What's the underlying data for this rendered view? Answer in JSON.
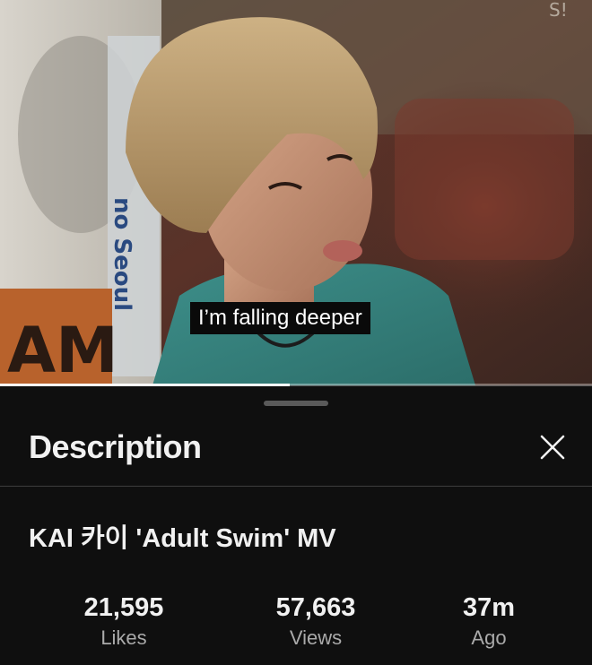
{
  "video": {
    "subtitle": "I’m falling deeper",
    "progress_fraction": 0.49
  },
  "sheet": {
    "title": "Description",
    "close_icon": "close-icon"
  },
  "description": {
    "video_title": "KAI 카이 'Adult Swim' MV"
  },
  "stats": {
    "likes": {
      "value": "21,595",
      "label": "Likes"
    },
    "views": {
      "value": "57,663",
      "label": "Views"
    },
    "age": {
      "value": "37m",
      "label": "Ago"
    }
  },
  "colors": {
    "background": "#0f0f0f",
    "text_primary": "#f1f1f1",
    "text_secondary": "#aaaaaa",
    "divider": "#3d3d3d",
    "subtitle_box": "#0a0a0a"
  }
}
